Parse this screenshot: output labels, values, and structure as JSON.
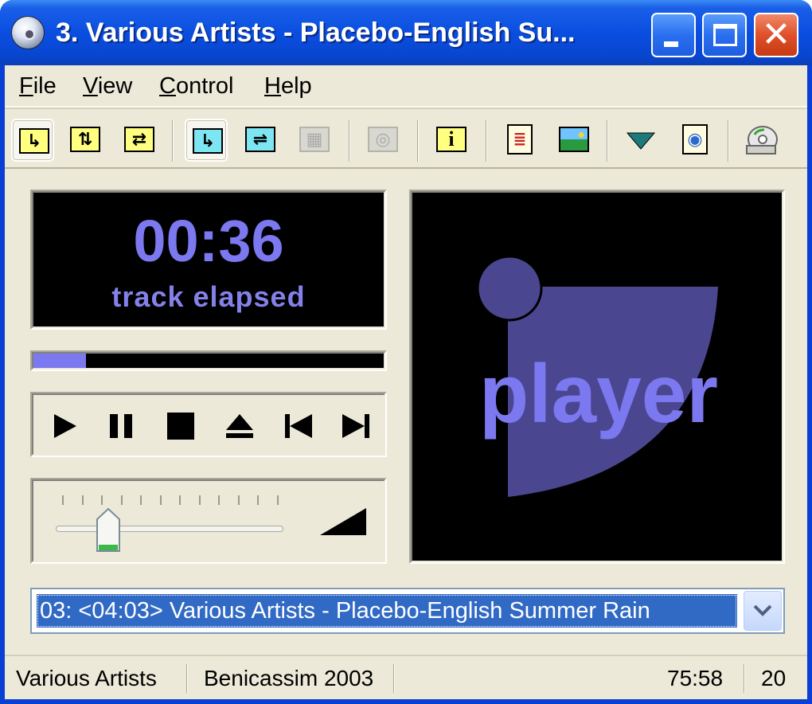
{
  "window": {
    "title": "3. Various Artists - Placebo-English Su...",
    "title_color": "#ffffff"
  },
  "menu": [
    "File",
    "View",
    "Control",
    "Help"
  ],
  "toolbar": {
    "icons": [
      "continuous-play-icon",
      "repeat-track-icon",
      "repeat-all-icon",
      "normal-order-icon",
      "shuffle-icon",
      "intro-scan-icon",
      "cd-info-disabled-icon",
      "info-icon",
      "playlist-icon",
      "album-art-icon",
      "download-arrow-icon",
      "web-lookup-icon",
      "cd-settings-icon"
    ]
  },
  "display": {
    "time": "00:36",
    "time_label": "track elapsed",
    "accent_color": "#7b78f0"
  },
  "progress": {
    "fraction": 0.15
  },
  "volume": {
    "fraction": 0.23
  },
  "logo": {
    "text": "player",
    "circle_color": "#4a4790",
    "text_color": "#7b78f0"
  },
  "track_select": {
    "value": "03: <04:03> Various Artists - Placebo-English Summer Rain"
  },
  "status": {
    "artist": "Various Artists",
    "album": "Benicassim 2003",
    "total_time": "75:58",
    "tracks": "20"
  }
}
